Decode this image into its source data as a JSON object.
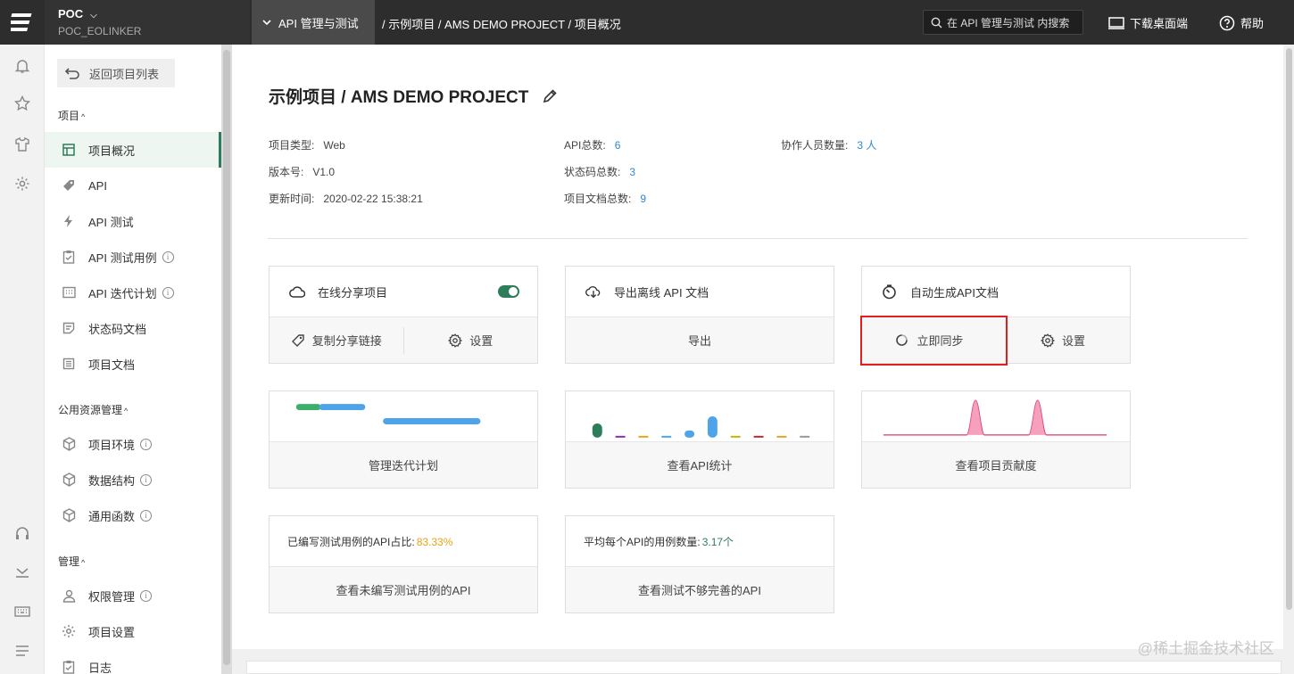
{
  "topbar": {
    "project_name": "POC",
    "project_caret": "⌵",
    "project_code": "POC_EOLINKER",
    "module": "API 管理与测试",
    "breadcrumb": "/ 示例项目 / AMS DEMO PROJECT  /  项目概况",
    "search_placeholder": "在 API 管理与测试 内搜索",
    "download_label": "下载桌面端",
    "help_label": "帮助"
  },
  "sidebar": {
    "back_label": "返回项目列表",
    "groups": [
      {
        "title": "项目",
        "items": [
          {
            "label": "项目概况",
            "icon": "table-icon",
            "active": true
          },
          {
            "label": "API",
            "icon": "tag-icon"
          },
          {
            "label": "API 测试",
            "icon": "bolt-icon"
          },
          {
            "label": "API 测试用例",
            "icon": "clipboard-check-icon",
            "info": true
          },
          {
            "label": "API 迭代计划",
            "icon": "calendar-icon",
            "info": true
          },
          {
            "label": "状态码文档",
            "icon": "code-doc-icon"
          },
          {
            "label": "项目文档",
            "icon": "doc-icon"
          }
        ]
      },
      {
        "title": "公用资源管理",
        "items": [
          {
            "label": "项目环境",
            "icon": "cube-icon",
            "info": true
          },
          {
            "label": "数据结构",
            "icon": "cube-icon",
            "info": true
          },
          {
            "label": "通用函数",
            "icon": "cube-icon",
            "info": true
          }
        ]
      },
      {
        "title": "管理",
        "items": [
          {
            "label": "权限管理",
            "icon": "user-icon",
            "info": true
          },
          {
            "label": "项目设置",
            "icon": "gear-icon"
          },
          {
            "label": "日志",
            "icon": "clipboard-icon"
          }
        ]
      }
    ]
  },
  "main": {
    "title": "示例项目 / AMS DEMO PROJECT",
    "meta": {
      "type_k": "项目类型:",
      "type_v": "Web",
      "version_k": "版本号:",
      "version_v": "V1.0",
      "updated_k": "更新时间:",
      "updated_v": "2020-02-22 15:38:21",
      "api_total_k": "API总数:",
      "api_total_v": "6",
      "status_total_k": "状态码总数:",
      "status_total_v": "3",
      "doc_total_k": "项目文档总数:",
      "doc_total_v": "9",
      "members_k": "协作人员数量:",
      "members_v": "3 人"
    },
    "cards": {
      "share_title": "在线分享项目",
      "share_enabled": true,
      "copy_link": "复制分享链接",
      "share_settings": "设置",
      "export_title": "导出离线 API 文档",
      "export_action": "导出",
      "autogen_title": "自动生成API文档",
      "sync_now": "立即同步",
      "autogen_settings": "设置",
      "iteration_action": "管理迭代计划",
      "stats_action": "查看API统计",
      "contrib_action": "查看项目贡献度",
      "coverage_label": "已编写测试用例的API占比:",
      "coverage_value": "83.33%",
      "coverage_action": "查看未编写测试用例的API",
      "avg_label": "平均每个API的用例数量:",
      "avg_value": "3.17个",
      "avg_action": "查看测试不够完善的API"
    }
  },
  "watermark": "@稀土掘金技术社区",
  "colors": {
    "accent": "#2e7d5a",
    "link": "#2f87d4",
    "highlight": "#e02020",
    "orange": "#e8a317"
  }
}
